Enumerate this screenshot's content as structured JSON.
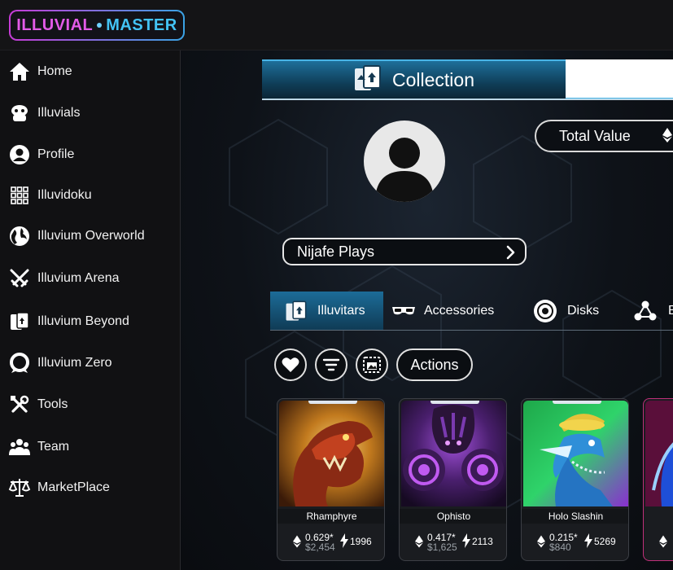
{
  "app": {
    "logo_left": "ILLUVIAL",
    "logo_right": "MASTER"
  },
  "sidebar": {
    "items": [
      {
        "label": "Home",
        "icon": "home-icon"
      },
      {
        "label": "Illuvials",
        "icon": "creature-icon"
      },
      {
        "label": "Profile",
        "icon": "user-circle-icon"
      },
      {
        "label": "Illuvidoku",
        "icon": "grid-icon"
      },
      {
        "label": "Illuvium Overworld",
        "icon": "globe-icon"
      },
      {
        "label": "Illuvium Arena",
        "icon": "crossed-swords-icon"
      },
      {
        "label": "Illuvium Beyond",
        "icon": "cards-icon"
      },
      {
        "label": "Illuvium Zero",
        "icon": "zero-ring-icon"
      },
      {
        "label": "Tools",
        "icon": "tools-icon"
      },
      {
        "label": "Team",
        "icon": "team-icon"
      },
      {
        "label": "MarketPlace",
        "icon": "scale-icon"
      }
    ]
  },
  "main": {
    "tabs": [
      {
        "label": "Collection",
        "active": true
      }
    ],
    "total_value_label": "Total Value",
    "username": "Nijafe Plays",
    "subtabs": [
      {
        "label": "Illuvitars",
        "icon": "cards-icon",
        "active": true
      },
      {
        "label": "Accessories",
        "icon": "goggles-icon",
        "active": false
      },
      {
        "label": "Disks",
        "icon": "disk-icon",
        "active": false
      },
      {
        "label": "B",
        "icon": "nodes-icon",
        "active": false
      }
    ],
    "actions_label": "Actions",
    "cards": [
      {
        "name": "Rhamphyre",
        "eth": "0.629*",
        "usd": "$2,454",
        "power": "1996"
      },
      {
        "name": "Ophisto",
        "eth": "0.417*",
        "usd": "$1,625",
        "power": "2113"
      },
      {
        "name": "Holo Slashin",
        "eth": "0.215*",
        "usd": "$840",
        "power": "5269"
      }
    ]
  },
  "colors": {
    "accent": "#1e6f9a",
    "logo_pink": "#e35be8",
    "logo_blue": "#43c3f5"
  }
}
